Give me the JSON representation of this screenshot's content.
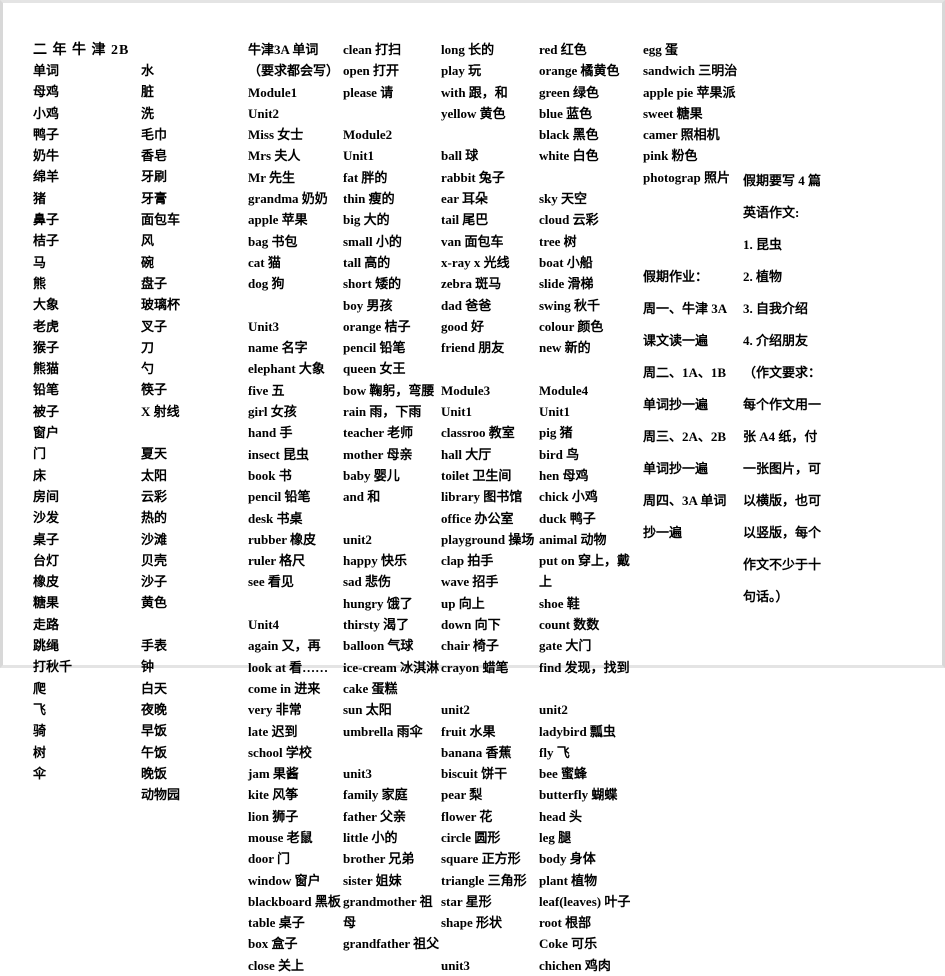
{
  "document": {
    "title": "二 年 牛 津  2B"
  },
  "columns": {
    "chinese_words_1": [
      "单词",
      "母鸡",
      "小鸡",
      "鸭子",
      "奶牛",
      "绵羊",
      "猪",
      "鼻子",
      "桔子",
      "马",
      "熊",
      "大象",
      "老虎",
      "猴子",
      "熊猫",
      "铅笔",
      "被子",
      "窗户",
      "门",
      "床",
      "房间",
      "沙发",
      "桌子",
      "台灯",
      "橡皮",
      "糖果",
      "走路",
      "跳绳",
      "打秋千",
      "爬",
      "飞",
      "骑",
      "树",
      "伞"
    ],
    "chinese_words_2": [
      "水",
      "脏",
      "洗",
      "毛巾",
      "香皂",
      "牙刷",
      "牙膏",
      "面包车",
      "风",
      "碗",
      "盘子",
      "玻璃杯",
      "叉子",
      "刀",
      "勺",
      "筷子",
      "X 射线",
      "",
      "夏天",
      "太阳",
      "云彩",
      "热的",
      "沙滩",
      "贝壳",
      "沙子",
      "黄色",
      "",
      "手表",
      "钟",
      "白天",
      "夜晚",
      "早饭",
      "午饭",
      "晚饭",
      "动物园"
    ],
    "oxford_3a_col1": [
      "牛津3A 单词",
      "（要求都会写）",
      "Module1",
      "Unit2",
      "Miss 女士",
      "Mrs 夫人",
      "Mr 先生",
      "grandma 奶奶",
      "apple 苹果",
      "bag 书包",
      "cat 猫",
      "dog 狗",
      "",
      "Unit3",
      "name 名字",
      "elephant 大象",
      "five 五",
      "girl 女孩",
      "hand 手",
      "insect 昆虫",
      "book 书",
      "pencil 铅笔",
      "desk 书桌",
      "rubber 橡皮",
      "ruler 格尺",
      "see 看见",
      "",
      "Unit4",
      "again 又，再",
      "look at 看……",
      "come in 进来",
      "very 非常",
      "late 迟到",
      "school 学校",
      "jam 果酱",
      "kite 风筝",
      "lion 狮子",
      "mouse 老鼠",
      "door 门",
      "window 窗户",
      "blackboard 黑板",
      "table 桌子",
      "box 盒子",
      "close 关上"
    ],
    "oxford_3a_col2": [
      "clean 打扫",
      "open 打开",
      "please 请",
      "",
      "Module2",
      "Unit1",
      "fat 胖的",
      "thin 瘦的",
      "big 大的",
      "small 小的",
      "tall 高的",
      "short 矮的",
      "boy 男孩",
      "orange 桔子",
      "pencil 铅笔",
      "queen 女王",
      "bow 鞠躬，弯腰",
      "rain 雨，下雨",
      "teacher 老师",
      "mother 母亲",
      "baby 婴儿",
      "and 和",
      "",
      "unit2",
      "happy 快乐",
      "sad 悲伤",
      "hungry 饿了",
      "thirsty 渴了",
      "balloon 气球",
      "ice-cream 冰淇淋",
      "cake 蛋糕",
      "sun 太阳",
      "umbrella 雨伞",
      "",
      "unit3",
      "family 家庭",
      "father 父亲",
      "little 小的",
      "brother 兄弟",
      "sister 姐妹",
      "grandmother 祖母",
      "grandfather 祖父"
    ],
    "oxford_3a_col3": [
      "long 长的",
      "play 玩",
      "with 跟，和",
      "yellow 黄色",
      "",
      "ball 球",
      "rabbit 兔子",
      "ear 耳朵",
      "tail 尾巴",
      "van 面包车",
      "x-ray  x 光线",
      "zebra 斑马",
      "dad 爸爸",
      "good 好",
      "friend 朋友",
      "",
      "Module3",
      "Unit1",
      "classroo 教室",
      "hall 大厅",
      "toilet 卫生间",
      "library 图书馆",
      "office 办公室",
      "playground 操场",
      "clap 拍手",
      "wave 招手",
      "up 向上",
      "down 向下",
      "chair 椅子",
      "crayon 蜡笔",
      "",
      "unit2",
      "fruit 水果",
      "banana 香蕉",
      "biscuit 饼干",
      "pear 梨",
      "flower 花",
      "circle 圆形",
      "square 正方形",
      "triangle 三角形",
      "star 星形",
      "shape 形状",
      "",
      "unit3"
    ],
    "oxford_3a_col4": [
      "red 红色",
      "orange 橘黄色",
      "green 绿色",
      "blue 蓝色",
      "black 黑色",
      "white 白色",
      "",
      "sky 天空",
      "cloud 云彩",
      "tree 树",
      "boat 小船",
      "slide 滑梯",
      "swing 秋千",
      "colour 颜色",
      "new 新的",
      "",
      "Module4",
      "Unit1",
      "pig 猪",
      "bird 鸟",
      "hen 母鸡",
      "chick 小鸡",
      "duck 鸭子",
      "animal 动物",
      "put on 穿上，戴上",
      "shoe 鞋",
      "count 数数",
      "gate 大门",
      "find 发现，找到",
      "",
      "unit2",
      "ladybird 瓢虫",
      "fly 飞",
      "bee 蜜蜂",
      "butterfly 蝴蝶",
      "head 头",
      "leg 腿",
      "body 身体",
      "plant 植物",
      "leaf(leaves) 叶子",
      "root 根部",
      "Coke 可乐",
      "chichen 鸡肉"
    ],
    "oxford_3a_col5": [
      "egg 蛋",
      "sandwich 三明治",
      "apple pie 苹果派",
      "sweet 糖果",
      "camer 照相机",
      "pink 粉色",
      "photograp 照片"
    ]
  },
  "notice": {
    "lines": [
      "假期要写 4 篇",
      "英语作文:",
      "1. 昆虫",
      "2. 植物",
      "3. 自我介绍",
      "4. 介绍朋友",
      "（作文要求：",
      "每个作文用一",
      "张 A4 纸，付",
      "一张图片，可",
      "以横版，也可",
      "以竖版，每个",
      "作文不少于十",
      "句话。）"
    ]
  },
  "homework": {
    "lines": [
      "假期作业：",
      "周一、牛津 3A",
      "课文读一遍",
      "周二、1A、1B",
      "单词抄一遍",
      "周三、2A、2B",
      "单词抄一遍",
      "周四、3A 单词",
      "抄一遍"
    ]
  }
}
